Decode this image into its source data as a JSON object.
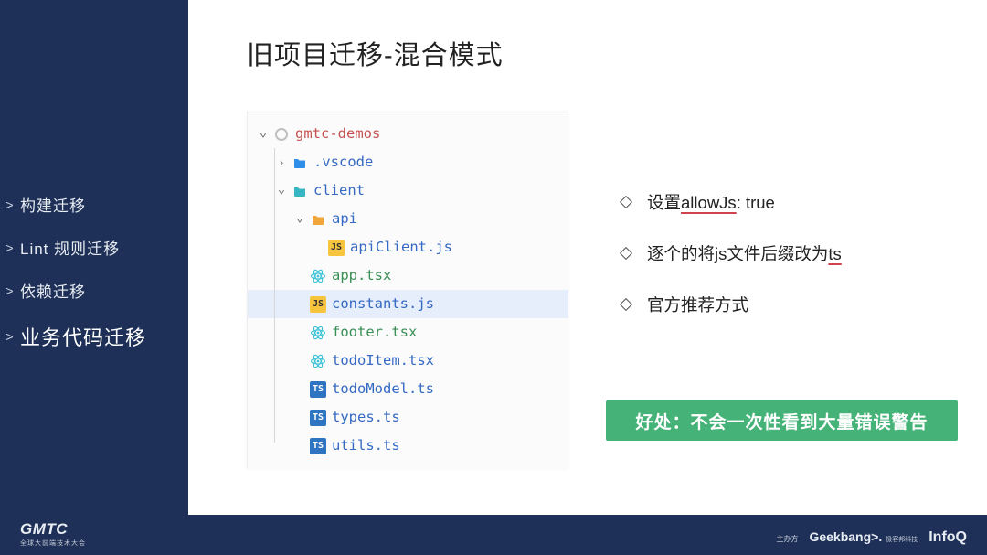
{
  "sidebar": {
    "items": [
      {
        "label": "构建迁移",
        "active": false
      },
      {
        "label": "Lint 规则迁移",
        "active": false
      },
      {
        "label": "依赖迁移",
        "active": false
      },
      {
        "label": "业务代码迁移",
        "active": true
      }
    ]
  },
  "title": "旧项目迁移-混合模式",
  "tree": {
    "rows": [
      {
        "indent": 0,
        "arrow": "down",
        "icon": "circle",
        "label": "gmtc-demos",
        "color": "red",
        "selected": false
      },
      {
        "indent": 1,
        "arrow": "right",
        "icon": "folder-blue",
        "label": ".vscode",
        "color": "blue",
        "selected": false
      },
      {
        "indent": 1,
        "arrow": "down",
        "icon": "folder-teal",
        "label": "client",
        "color": "blue",
        "selected": false
      },
      {
        "indent": 2,
        "arrow": "down",
        "icon": "folder-amber",
        "label": "api",
        "color": "blue",
        "selected": false
      },
      {
        "indent": 3,
        "arrow": "",
        "icon": "js",
        "label": "apiClient.js",
        "color": "blue",
        "selected": false
      },
      {
        "indent": 2,
        "arrow": "",
        "icon": "react",
        "label": "app.tsx",
        "color": "green",
        "selected": false
      },
      {
        "indent": 2,
        "arrow": "",
        "icon": "js",
        "label": "constants.js",
        "color": "blue",
        "selected": true
      },
      {
        "indent": 2,
        "arrow": "",
        "icon": "react",
        "label": "footer.tsx",
        "color": "green",
        "selected": false
      },
      {
        "indent": 2,
        "arrow": "",
        "icon": "react",
        "label": "todoItem.tsx",
        "color": "blue",
        "selected": false
      },
      {
        "indent": 2,
        "arrow": "",
        "icon": "ts",
        "label": "todoModel.ts",
        "color": "blue",
        "selected": false
      },
      {
        "indent": 2,
        "arrow": "",
        "icon": "ts",
        "label": "types.ts",
        "color": "blue",
        "selected": false
      },
      {
        "indent": 2,
        "arrow": "",
        "icon": "ts",
        "label": "utils.ts",
        "color": "blue",
        "selected": false
      }
    ],
    "icon_text": {
      "js": "JS",
      "ts": "TS"
    }
  },
  "bullets": [
    {
      "pre": "设置",
      "u": "allowJs",
      "post": ": true"
    },
    {
      "pre": "逐个的将js文件后缀改为",
      "u": "ts",
      "post": ""
    },
    {
      "pre": "官方推荐方式",
      "u": "",
      "post": ""
    }
  ],
  "callout": "好处：不会一次性看到大量错误警告",
  "footer": {
    "logo_main": "GMTC",
    "logo_sub": "全球大前端技术大会",
    "host_label": "主办方",
    "geekbang": "Geekbang>.",
    "geekbang_sub": "极客邦科技",
    "infoq": "InfoQ"
  }
}
